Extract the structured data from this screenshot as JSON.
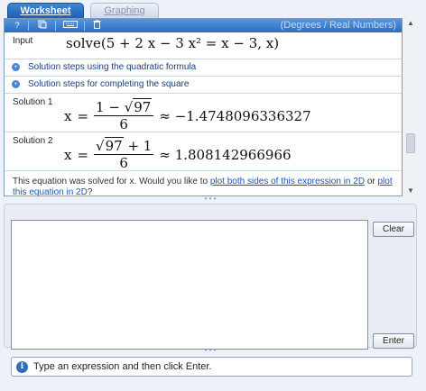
{
  "tabs": [
    {
      "label": "Worksheet",
      "active": true
    },
    {
      "label": "Graphing",
      "active": false
    }
  ],
  "toolbar": {
    "help_label": "?",
    "mode": "(Degrees / Real Numbers)"
  },
  "input": {
    "label": "Input",
    "expression": "solve(5 + 2 x − 3 x² = x − 3, x)"
  },
  "steps": [
    {
      "label": "Solution steps using the quadratic formula"
    },
    {
      "label": "Solution steps for completing the square"
    }
  ],
  "solutions": [
    {
      "label": "Solution 1",
      "var": "x",
      "numerator_prefix": "1 − ",
      "radicand": "97",
      "numerator_suffix": "",
      "denominator": "6",
      "approx": "≈ −1.4748096336327"
    },
    {
      "label": "Solution 2",
      "var": "x",
      "numerator_prefix": "",
      "radicand": "97",
      "numerator_suffix": " + 1",
      "denominator": "6",
      "approx": "≈ 1.808142966966"
    }
  ],
  "note": {
    "text_before": "This equation was solved for x. Would you like to ",
    "link1": "plot both sides of this expression in 2D",
    "text_middle": " or ",
    "link2": "plot this equation in 2D",
    "text_after": "?"
  },
  "splitter_glyph": "• • •",
  "buttons": {
    "clear": "Clear",
    "enter": "Enter"
  },
  "status": {
    "text": "Type an expression and then click Enter."
  },
  "colors": {
    "tab_active": "#1c5fb4",
    "toolbar": "#2a6ec0",
    "link": "#1a55c6"
  }
}
